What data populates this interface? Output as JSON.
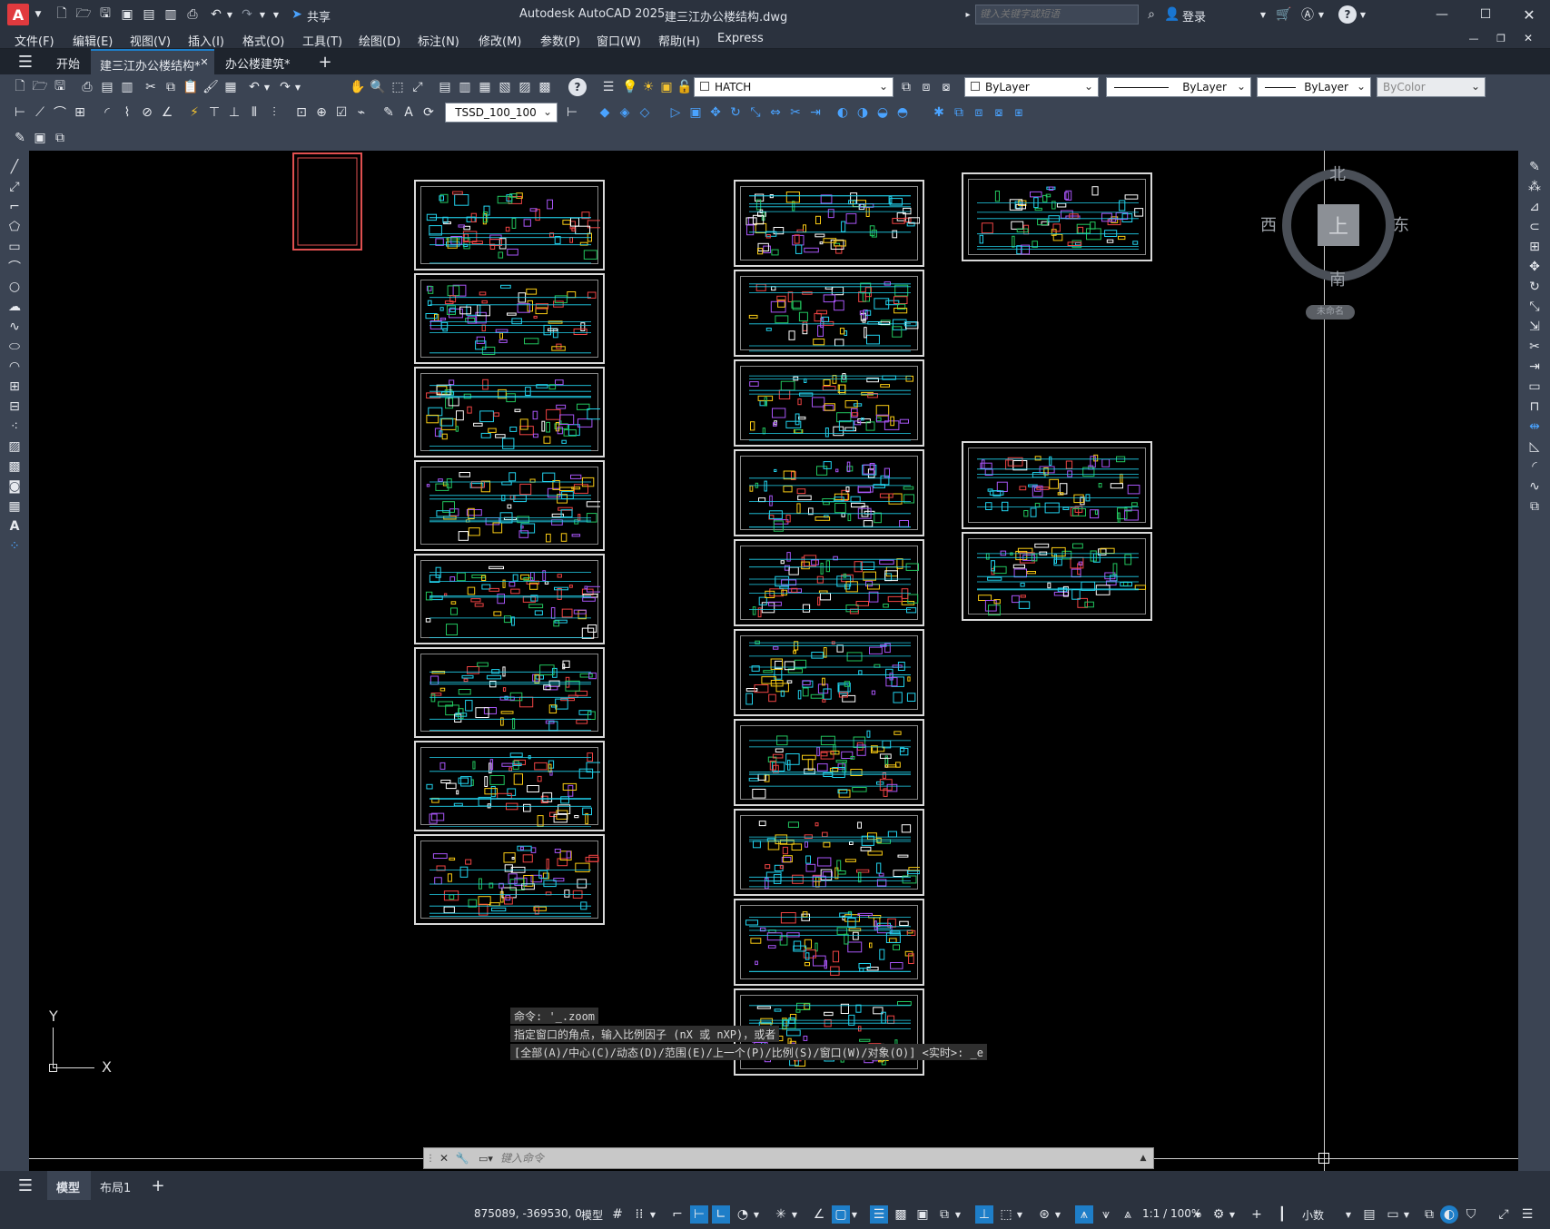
{
  "app": {
    "title": "Autodesk AutoCAD 2025",
    "filename": "建三江办公楼结构.dwg",
    "share_label": "共享",
    "search_placeholder": "键入关键字或短语",
    "login_label": "登录",
    "logo_letter": "A"
  },
  "menu": [
    "文件(F)",
    "编辑(E)",
    "视图(V)",
    "插入(I)",
    "格式(O)",
    "工具(T)",
    "绘图(D)",
    "标注(N)",
    "修改(M)",
    "参数(P)",
    "窗口(W)",
    "帮助(H)",
    "Express"
  ],
  "tabs": {
    "start": "开始",
    "items": [
      "建三江办公楼结构*",
      "办公楼建筑*"
    ],
    "active_index": 0
  },
  "toolbar": {
    "layer_name": "HATCH",
    "color_value": "ByLayer",
    "linetype_value": "ByLayer",
    "lineweight_value": "ByLayer",
    "plotstyle_value": "ByColor",
    "dimstyle_value": "TSSD_100_100"
  },
  "viewcube": {
    "north": "北",
    "south": "南",
    "east": "东",
    "west": "西",
    "face": "上",
    "wcs": "未命名"
  },
  "ucs": {
    "y_label": "Y",
    "x_label": "X"
  },
  "command": {
    "history": [
      "命令: '_.zoom",
      "指定窗口的角点，输入比例因子 (nX 或 nXP)，或者",
      "[全部(A)/中心(C)/动态(D)/范围(E)/上一个(P)/比例(S)/窗口(W)/对象(O)] <实时>: _e"
    ],
    "placeholder": "键入命令"
  },
  "layouts": {
    "model": "模型",
    "layout1": "布局1"
  },
  "status": {
    "coords": "875089, -369530, 0",
    "space": "模型",
    "scale": "1:1 / 100%",
    "units": "小数"
  },
  "colors": {
    "accent": "#1e7ec8",
    "logo": "#e03a3e",
    "canvas": "#000000"
  }
}
